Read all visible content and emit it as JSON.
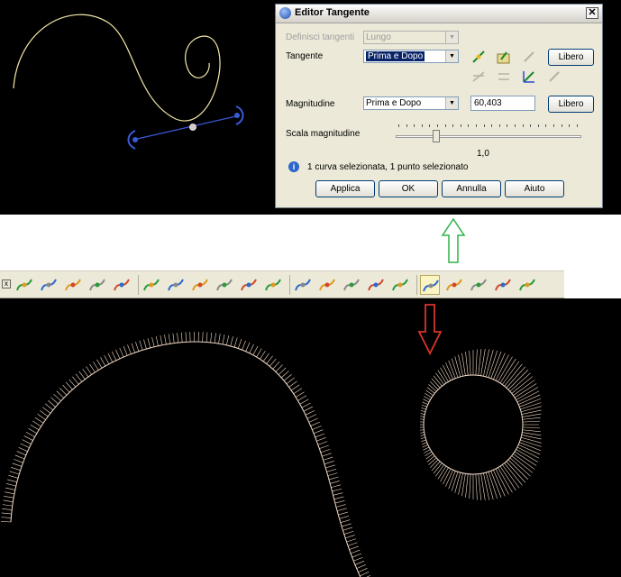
{
  "dialog": {
    "title": "Editor Tangente",
    "close_label": "✕",
    "define_label": "Definisci tangenti",
    "define_value": "Lungo",
    "tangent_label": "Tangente",
    "tangent_value": "Prima e Dopo",
    "free_label_1": "Libero",
    "magnitude_label": "Magnitudine",
    "magnitude_mode": "Prima e Dopo",
    "magnitude_value": "60,403",
    "free_label_2": "Libero",
    "scale_label": "Scala magnitudine",
    "scale_value": "1,0",
    "scale_level_fraction": 0.22,
    "status_text": "1 curva selezionata, 1 punto selezionato",
    "buttons": {
      "apply": "Applica",
      "ok": "OK",
      "cancel": "Annulla",
      "help": "Aiuto"
    }
  },
  "toolbar": {
    "close_label": "x",
    "tools": [
      {
        "icon": "select-arrow-icon"
      },
      {
        "icon": "curve-tool-1-icon"
      },
      {
        "icon": "curve-tool-2-icon"
      },
      {
        "icon": "curve-tool-3-icon"
      },
      {
        "icon": "curve-tool-4-icon"
      },
      {
        "icon": "surface-tool-icon"
      },
      {
        "icon": "wave-surface-icon"
      },
      {
        "icon": "bend-surface-icon"
      },
      {
        "icon": "numbered-grid-icon"
      },
      {
        "icon": "arrows-surface-icon"
      },
      {
        "icon": "shapes-icon"
      },
      {
        "icon": "curve-edit-1-icon"
      },
      {
        "icon": "curve-edit-2-icon"
      },
      {
        "icon": "curve-edit-3-icon"
      },
      {
        "icon": "curve-edit-4-icon"
      },
      {
        "icon": "curve-degree-icon"
      },
      {
        "icon": "tangent-editor-icon",
        "active": true
      },
      {
        "icon": "tangent-7-icon"
      },
      {
        "icon": "curve-analysis-icon"
      },
      {
        "icon": "curve-edit-5-icon"
      },
      {
        "icon": "arch-curve-icon"
      }
    ]
  },
  "colors": {
    "viewport_bg": "#000000",
    "curve": "#f3e9a8",
    "handles": "#3a5bd8",
    "comb": "#f4dcc8",
    "arrow_green": "#2fb34a",
    "arrow_red": "#d9352a"
  }
}
